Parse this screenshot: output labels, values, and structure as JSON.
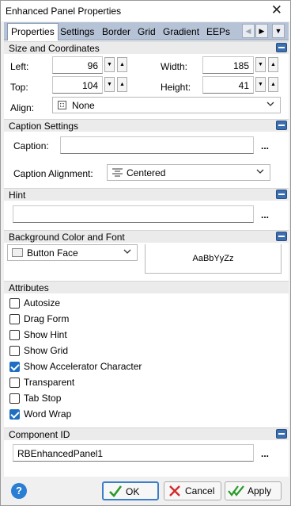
{
  "window": {
    "title": "Enhanced Panel Properties"
  },
  "tabs": [
    "Properties",
    "Settings",
    "Border",
    "Grid",
    "Gradient",
    "EEPs"
  ],
  "size": {
    "header": "Size and Coordinates",
    "left_label": "Left:",
    "left_value": "96",
    "width_label": "Width:",
    "width_value": "185",
    "top_label": "Top:",
    "top_value": "104",
    "height_label": "Height:",
    "height_value": "41",
    "align_label": "Align:",
    "align_value": "None"
  },
  "caption": {
    "header": "Caption Settings",
    "caption_label": "Caption:",
    "caption_value": "",
    "alignment_label": "Caption Alignment:",
    "alignment_value": "Centered"
  },
  "hint": {
    "header": "Hint",
    "value": ""
  },
  "background": {
    "header": "Background Color and Font",
    "color_value": "Button Face",
    "font_sample": "AaBbYyZz"
  },
  "attributes": {
    "header": "Attributes",
    "items": [
      {
        "label": "Autosize",
        "checked": false
      },
      {
        "label": "Drag Form",
        "checked": false
      },
      {
        "label": "Show Hint",
        "checked": false
      },
      {
        "label": "Show Grid",
        "checked": false
      },
      {
        "label": "Show Accelerator Character",
        "checked": true
      },
      {
        "label": "Transparent",
        "checked": false
      },
      {
        "label": "Tab Stop",
        "checked": false
      },
      {
        "label": "Word Wrap",
        "checked": true
      }
    ]
  },
  "component": {
    "header": "Component ID",
    "value": "RBEnhancedPanel1"
  },
  "buttons": {
    "ok": "OK",
    "cancel": "Cancel",
    "apply": "Apply"
  },
  "colors": {
    "accent": "#1e6fc2",
    "tab_strip": "#b6c3d6",
    "ok_green": "#2a9a2a",
    "cancel_red": "#d42a2a"
  }
}
